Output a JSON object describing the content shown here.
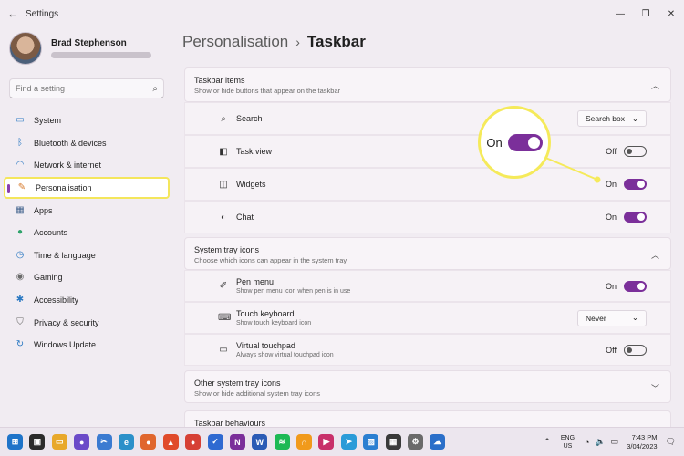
{
  "window": {
    "back_glyph": "←",
    "title": "Settings",
    "minimize_glyph": "—",
    "restore_glyph": "❐",
    "close_glyph": "✕"
  },
  "profile": {
    "name": "Brad Stephenson"
  },
  "search": {
    "placeholder": "Find a setting",
    "icon": "search-icon"
  },
  "nav": {
    "items": [
      {
        "label": "System",
        "icon": "monitor-icon",
        "color": "#2a78c2"
      },
      {
        "label": "Bluetooth & devices",
        "icon": "bluetooth-icon",
        "color": "#2a78c2"
      },
      {
        "label": "Network & internet",
        "icon": "wifi-icon",
        "color": "#2a78c2"
      },
      {
        "label": "Personalisation",
        "icon": "brush-icon",
        "color": "#d77a2c"
      },
      {
        "label": "Apps",
        "icon": "apps-icon",
        "color": "#3d5f8a"
      },
      {
        "label": "Accounts",
        "icon": "person-icon",
        "color": "#2fa36b"
      },
      {
        "label": "Time & language",
        "icon": "globe-clock-icon",
        "color": "#2a78c2"
      },
      {
        "label": "Gaming",
        "icon": "gamepad-icon",
        "color": "#6a6a6a"
      },
      {
        "label": "Accessibility",
        "icon": "accessibility-icon",
        "color": "#2a78c2"
      },
      {
        "label": "Privacy & security",
        "icon": "shield-icon",
        "color": "#6a6a6a"
      },
      {
        "label": "Windows Update",
        "icon": "update-icon",
        "color": "#2a78c2"
      }
    ],
    "active_index": 3
  },
  "breadcrumb": {
    "parent": "Personalisation",
    "separator": "›",
    "current": "Taskbar"
  },
  "sections": {
    "taskbar_items": {
      "title": "Taskbar items",
      "subtitle": "Show or hide buttons that appear on the taskbar",
      "rows": [
        {
          "label": "Search",
          "icon": "search-icon",
          "control": "dropdown",
          "value": "Search box"
        },
        {
          "label": "Task view",
          "icon": "task-view-icon",
          "control": "toggle",
          "state": "Off"
        },
        {
          "label": "Widgets",
          "icon": "widgets-icon",
          "control": "toggle",
          "state": "On"
        },
        {
          "label": "Chat",
          "icon": "chat-icon",
          "control": "toggle",
          "state": "On"
        }
      ]
    },
    "system_tray": {
      "title": "System tray icons",
      "subtitle": "Choose which icons can appear in the system tray",
      "rows": [
        {
          "label": "Pen menu",
          "sub": "Show pen menu icon when pen is in use",
          "icon": "pen-icon",
          "control": "toggle",
          "state": "On"
        },
        {
          "label": "Touch keyboard",
          "sub": "Show touch keyboard icon",
          "icon": "keyboard-icon",
          "control": "dropdown",
          "value": "Never"
        },
        {
          "label": "Virtual touchpad",
          "sub": "Always show virtual touchpad icon",
          "icon": "touchpad-icon",
          "control": "toggle",
          "state": "Off"
        }
      ]
    },
    "other_tray": {
      "title": "Other system tray icons",
      "subtitle": "Show or hide additional system tray icons"
    },
    "behaviours": {
      "title": "Taskbar behaviours"
    }
  },
  "callout": {
    "label": "On"
  },
  "taskbar": {
    "apps": [
      {
        "icon": "windows-start-icon",
        "color": "#1f74c9",
        "glyph": "⊞"
      },
      {
        "icon": "task-view-icon",
        "color": "#2b2b2b",
        "glyph": "▣"
      },
      {
        "icon": "file-explorer-icon",
        "color": "#e8a82a",
        "glyph": "▭"
      },
      {
        "icon": "video-call-icon",
        "color": "#6b4ac8",
        "glyph": "●"
      },
      {
        "icon": "snipping-tool-icon",
        "color": "#3b7bd1",
        "glyph": "✂"
      },
      {
        "icon": "edge-browser-icon",
        "color": "#2b90c9",
        "glyph": "e"
      },
      {
        "icon": "firefox-icon",
        "color": "#e0662d",
        "glyph": "●"
      },
      {
        "icon": "brave-browser-icon",
        "color": "#e04a2a",
        "glyph": "▲"
      },
      {
        "icon": "chrome-icon",
        "color": "#d64035",
        "glyph": "●"
      },
      {
        "icon": "todo-icon",
        "color": "#2f6ad1",
        "glyph": "✓"
      },
      {
        "icon": "onenote-icon",
        "color": "#7b2f9a",
        "glyph": "N"
      },
      {
        "icon": "word-icon",
        "color": "#2b5bb5",
        "glyph": "W"
      },
      {
        "icon": "spotify-icon",
        "color": "#1db954",
        "glyph": "≋"
      },
      {
        "icon": "audible-icon",
        "color": "#f19a1b",
        "glyph": "∩"
      },
      {
        "icon": "media-player-icon",
        "color": "#c8306a",
        "glyph": "▶"
      },
      {
        "icon": "telegram-icon",
        "color": "#2a9bd8",
        "glyph": "➤"
      },
      {
        "icon": "photos-icon",
        "color": "#2b7fd1",
        "glyph": "▨"
      },
      {
        "icon": "store-icon",
        "color": "#3a3a3a",
        "glyph": "▦"
      },
      {
        "icon": "settings-gear-icon",
        "color": "#6a6a6a",
        "glyph": "⚙"
      },
      {
        "icon": "onedrive-icon",
        "color": "#2b6fc9",
        "glyph": "☁"
      }
    ],
    "tray": {
      "chevron_glyph": "⌃",
      "language_line1": "ENG",
      "language_line2": "US",
      "wifi_glyph": "◔",
      "volume_glyph": "🔈",
      "battery_glyph": "▭",
      "time": "7:43 PM",
      "date": "3/04/2023",
      "notification_glyph": "🗨"
    }
  }
}
